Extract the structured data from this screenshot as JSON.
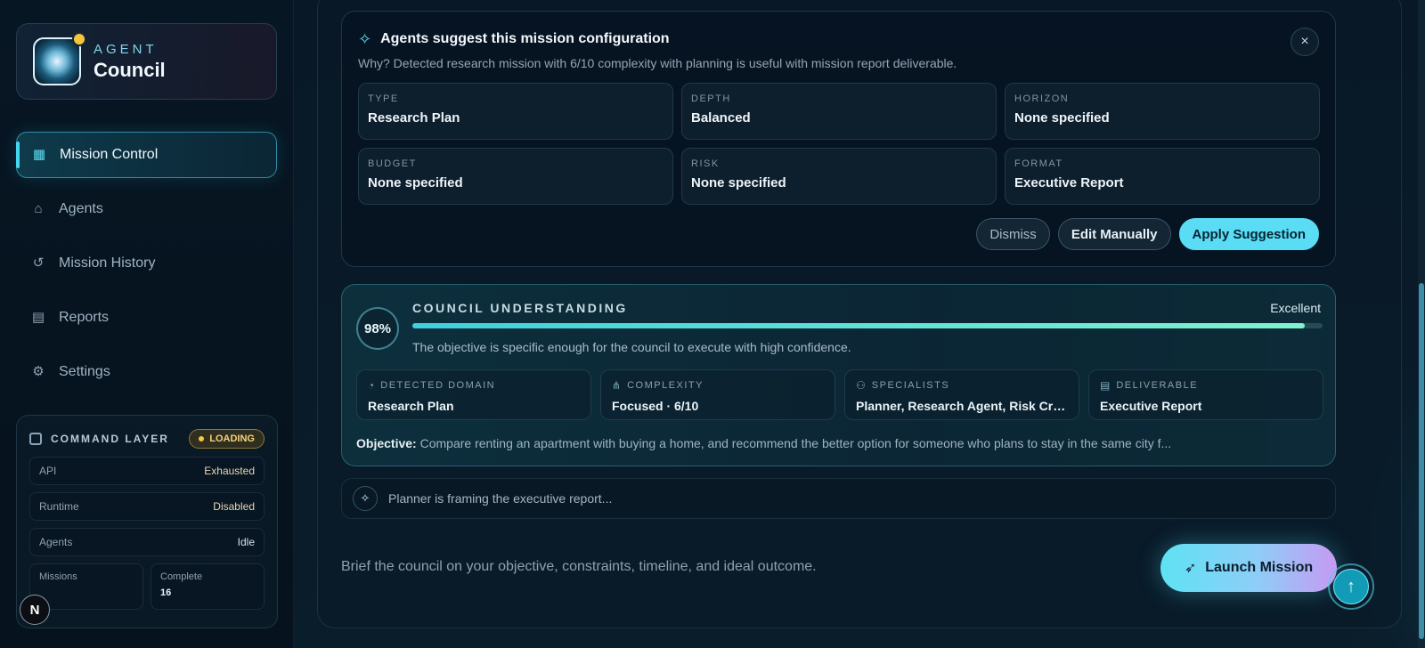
{
  "brand": {
    "kicker": "AGENT",
    "title": "Council"
  },
  "nav": [
    {
      "label": "Mission Control",
      "icon": "grid-icon",
      "active": true
    },
    {
      "label": "Agents",
      "icon": "robot-icon"
    },
    {
      "label": "Mission History",
      "icon": "history-icon"
    },
    {
      "label": "Reports",
      "icon": "document-icon"
    },
    {
      "label": "Settings",
      "icon": "gear-icon"
    }
  ],
  "command": {
    "title": "COMMAND LAYER",
    "badge": "LOADING",
    "rows": [
      {
        "key": "API",
        "value": "Exhausted"
      },
      {
        "key": "Runtime",
        "value": "Disabled"
      },
      {
        "key": "Agents",
        "value": "Idle"
      }
    ],
    "missions_label": "Missions",
    "missions_value": "",
    "complete_label": "Complete",
    "complete_value": "16"
  },
  "corner_badge": "N",
  "suggestion": {
    "title": "Agents suggest this mission configuration",
    "why": "Why? Detected research mission with 6/10 complexity with planning is useful with mission report deliverable.",
    "fields": [
      {
        "key": "TYPE",
        "value": "Research Plan"
      },
      {
        "key": "DEPTH",
        "value": "Balanced"
      },
      {
        "key": "HORIZON",
        "value": "None specified"
      },
      {
        "key": "BUDGET",
        "value": "None specified"
      },
      {
        "key": "RISK",
        "value": "None specified"
      },
      {
        "key": "FORMAT",
        "value": "Executive Report"
      }
    ],
    "dismiss": "Dismiss",
    "edit": "Edit Manually",
    "apply": "Apply Suggestion",
    "close": "×"
  },
  "understanding": {
    "percent": "98%",
    "progress": 0.98,
    "title": "COUNCIL UNDERSTANDING",
    "grade": "Excellent",
    "description": "The objective is specific enough for the council to execute with high confidence.",
    "cards": [
      {
        "key": "DETECTED DOMAIN",
        "value": "Research Plan",
        "icon": "domain-icon"
      },
      {
        "key": "COMPLEXITY",
        "value": "Focused · 6/10",
        "icon": "hierarchy-icon"
      },
      {
        "key": "SPECIALISTS",
        "value": "Planner, Research Agent, Risk Critic, T...",
        "icon": "users-icon"
      },
      {
        "key": "DELIVERABLE",
        "value": "Executive Report",
        "icon": "file-icon"
      }
    ],
    "objective_label": "Objective:",
    "objective": "Compare renting an apartment with buying a home, and recommend the better option for someone who plans to stay in the same city f..."
  },
  "status": {
    "text": "Planner is framing the executive report..."
  },
  "brief_placeholder": "Brief the council on your objective, constraints, timeline, and ideal outcome.",
  "launch_label": "Launch Mission",
  "colors": {
    "accent": "#59dcf4",
    "warning": "#f3c94a",
    "background": "#06111c"
  }
}
